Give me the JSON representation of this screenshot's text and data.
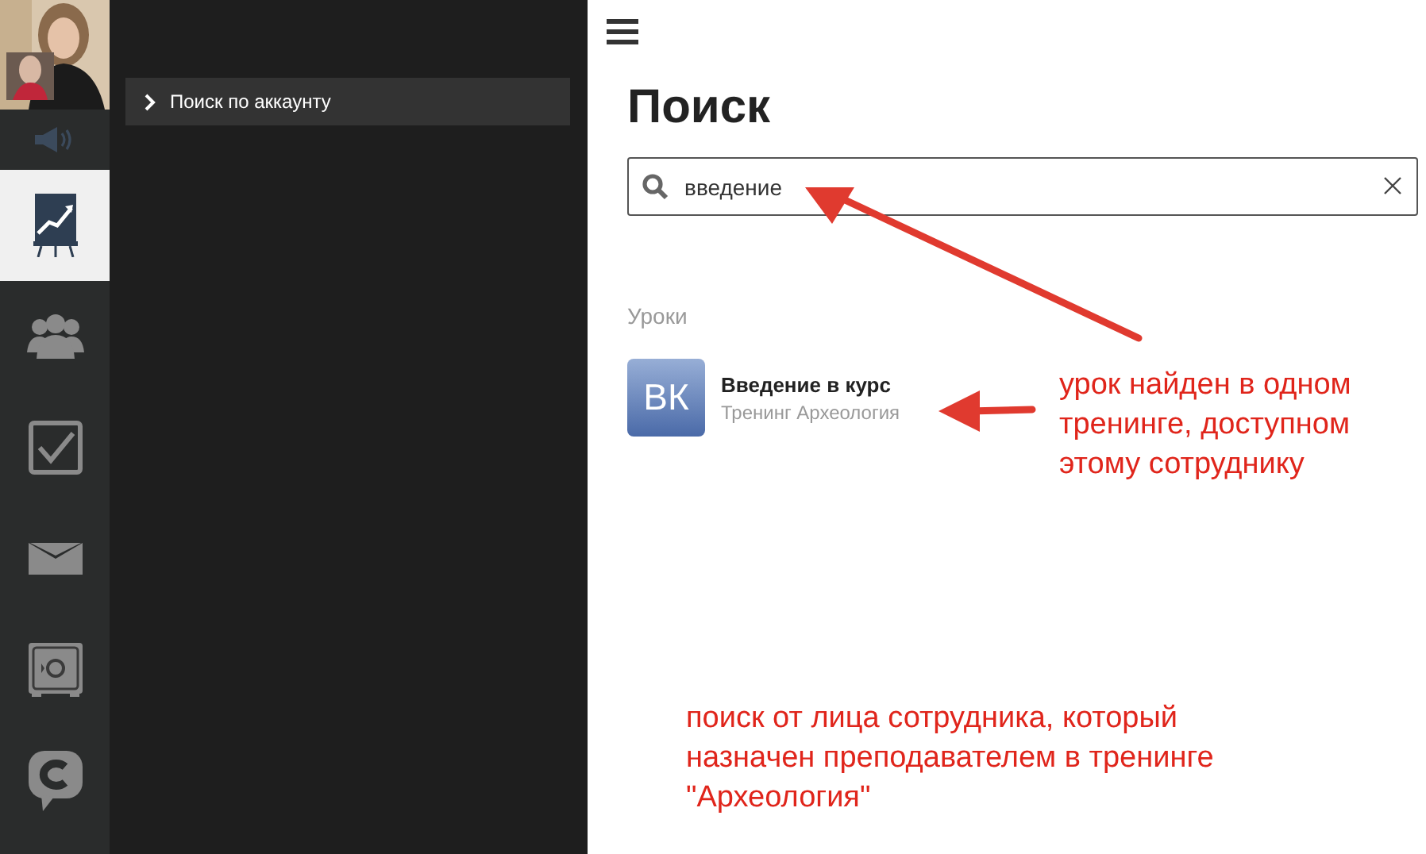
{
  "rail": [
    {
      "kind": "speaker",
      "selected": false
    },
    {
      "kind": "chart",
      "selected": true
    },
    {
      "kind": "users",
      "selected": false
    },
    {
      "kind": "tasks",
      "selected": false
    },
    {
      "kind": "mail",
      "selected": false
    },
    {
      "kind": "safe",
      "selected": false
    },
    {
      "kind": "chat",
      "selected": false
    }
  ],
  "panel": {
    "items": [
      {
        "label": "Поиск по аккаунту",
        "selected": false
      }
    ]
  },
  "title": "Поиск",
  "search": {
    "value": "введение"
  },
  "section": "Уроки",
  "results": [
    {
      "thumb": "ВК",
      "title": "Введение в курс",
      "subtitle": "Тренинг Археология"
    }
  ],
  "annotations": [
    {
      "text": "урок найден в одном\nтренинге, доступном\nэтому сотруднику"
    },
    {
      "text": "поиск от лица сотрудника, который\nназначен преподавателем в тренинге\n\"Археология\""
    }
  ]
}
